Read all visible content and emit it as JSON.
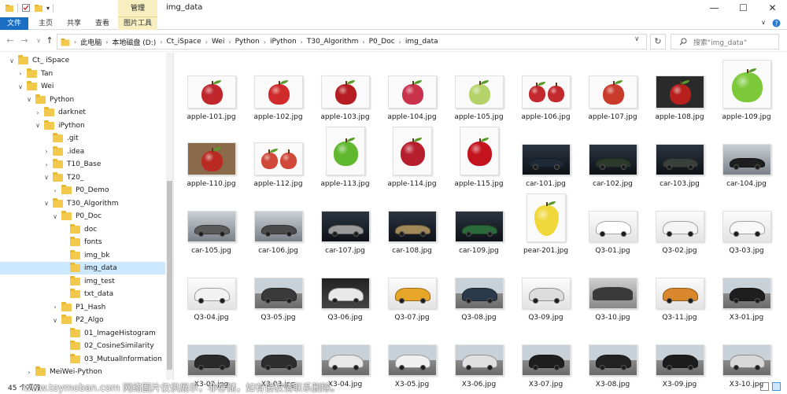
{
  "window": {
    "title": "img_data",
    "manage_tab": "管理",
    "controls": {
      "minimize": "—",
      "maximize": "☐",
      "close": "✕"
    }
  },
  "ribbon": {
    "tabs": [
      "文件",
      "主页",
      "共享",
      "查看",
      "图片工具"
    ],
    "accent": "#1a6fc4",
    "picture_tools_color": "#f7efc0"
  },
  "address": {
    "crumbs": [
      "此电脑",
      "本地磁盘 (D:)",
      "Ct_iSpace",
      "Wei",
      "Python",
      "iPython",
      "T30_Algorithm",
      "P0_Doc",
      "img_data"
    ],
    "search_placeholder": "搜索\"img_data\""
  },
  "nav_tree": [
    {
      "label": "Ct_ iSpace",
      "indent": 0,
      "chev": "∨"
    },
    {
      "label": "Tan",
      "indent": 1,
      "chev": "›"
    },
    {
      "label": "Wei",
      "indent": 1,
      "chev": "∨"
    },
    {
      "label": "Python",
      "indent": 2,
      "chev": "∨"
    },
    {
      "label": "darknet",
      "indent": 3,
      "chev": "›"
    },
    {
      "label": "iPython",
      "indent": 3,
      "chev": "∨"
    },
    {
      "label": ".git",
      "indent": 4,
      "chev": ""
    },
    {
      "label": ".idea",
      "indent": 4,
      "chev": "›"
    },
    {
      "label": "T10_Base",
      "indent": 4,
      "chev": "›"
    },
    {
      "label": "T20_",
      "indent": 4,
      "chev": "∨"
    },
    {
      "label": "P0_Demo",
      "indent": 5,
      "chev": "›"
    },
    {
      "label": "T30_Algorithm",
      "indent": 4,
      "chev": "∨"
    },
    {
      "label": "P0_Doc",
      "indent": 5,
      "chev": "∨"
    },
    {
      "label": "doc",
      "indent": 6,
      "chev": ""
    },
    {
      "label": "fonts",
      "indent": 6,
      "chev": ""
    },
    {
      "label": "img_bk",
      "indent": 6,
      "chev": ""
    },
    {
      "label": "img_data",
      "indent": 6,
      "chev": "",
      "selected": true
    },
    {
      "label": "img_test",
      "indent": 6,
      "chev": ""
    },
    {
      "label": "txt_data",
      "indent": 6,
      "chev": ""
    },
    {
      "label": "P1_Hash",
      "indent": 5,
      "chev": "›"
    },
    {
      "label": "P2_Algo",
      "indent": 5,
      "chev": "∨"
    },
    {
      "label": "01_ImageHistogram",
      "indent": 6,
      "chev": ""
    },
    {
      "label": "02_CosineSimilarity",
      "indent": 6,
      "chev": ""
    },
    {
      "label": "03_MutualInformation",
      "indent": 6,
      "chev": ""
    },
    {
      "label": "MeiWei-Python",
      "indent": 2,
      "chev": "›"
    }
  ],
  "files": [
    {
      "name": "apple-101.jpg",
      "kind": "apple",
      "color": "#c0272d"
    },
    {
      "name": "apple-102.jpg",
      "kind": "apple",
      "color": "#d02a2a"
    },
    {
      "name": "apple-103.jpg",
      "kind": "apple",
      "color": "#b51d22"
    },
    {
      "name": "apple-104.jpg",
      "kind": "apple",
      "color": "#c8324a"
    },
    {
      "name": "apple-105.jpg",
      "kind": "apple",
      "color": "#b5d36a"
    },
    {
      "name": "apple-106.jpg",
      "kind": "apple2",
      "color": "#c2282c"
    },
    {
      "name": "apple-107.jpg",
      "kind": "apple",
      "color": "#c93a2a"
    },
    {
      "name": "apple-108.jpg",
      "kind": "apple-dark",
      "color": "#b8201e"
    },
    {
      "name": "apple-109.jpg",
      "kind": "apple",
      "color": "#7cc93a"
    },
    {
      "name": "apple-110.jpg",
      "kind": "apple-wood",
      "color": "#b82a22"
    },
    {
      "name": "apple-112.jpg",
      "kind": "apple2",
      "color": "#d0483a"
    },
    {
      "name": "apple-113.jpg",
      "kind": "apple",
      "color": "#5fb82e"
    },
    {
      "name": "apple-114.jpg",
      "kind": "apple",
      "color": "#b81f2e"
    },
    {
      "name": "apple-115.jpg",
      "kind": "apple",
      "color": "#c3141e"
    },
    {
      "name": "car-101.jpg",
      "kind": "car-dark",
      "color": "#1e2a38"
    },
    {
      "name": "car-102.jpg",
      "kind": "car-dark",
      "color": "#2c3a2c"
    },
    {
      "name": "car-103.jpg",
      "kind": "car-dark",
      "color": "#3a3f3a"
    },
    {
      "name": "car-104.jpg",
      "kind": "car-grey",
      "color": "#1e1e1e"
    },
    {
      "name": "car-105.jpg",
      "kind": "car-grey",
      "color": "#5a5a5a"
    },
    {
      "name": "car-106.jpg",
      "kind": "car-grey",
      "color": "#4a4a4a"
    },
    {
      "name": "car-107.jpg",
      "kind": "car-dark",
      "color": "#9a9a9a"
    },
    {
      "name": "car-108.jpg",
      "kind": "car-dark",
      "color": "#a08858"
    },
    {
      "name": "car-109.jpg",
      "kind": "car-dark",
      "color": "#2a6a3a"
    },
    {
      "name": "pear-201.jpg",
      "kind": "pear",
      "color": "#f0d83a"
    },
    {
      "name": "Q3-01.jpg",
      "kind": "suv",
      "color": "#ffffff"
    },
    {
      "name": "Q3-02.jpg",
      "kind": "suv",
      "color": "#f4f4f4"
    },
    {
      "name": "Q3-03.jpg",
      "kind": "suv",
      "color": "#f8f8f8"
    },
    {
      "name": "Q3-04.jpg",
      "kind": "suv",
      "color": "#f2f2f2"
    },
    {
      "name": "Q3-05.jpg",
      "kind": "suv-road",
      "color": "#3a3a3a"
    },
    {
      "name": "Q3-06.jpg",
      "kind": "suv-dark",
      "color": "#e8e8e8"
    },
    {
      "name": "Q3-07.jpg",
      "kind": "suv",
      "color": "#e8a628"
    },
    {
      "name": "Q3-08.jpg",
      "kind": "suv-road",
      "color": "#2a3a4a"
    },
    {
      "name": "Q3-09.jpg",
      "kind": "suv",
      "color": "#dcdcdc"
    },
    {
      "name": "Q3-10.jpg",
      "kind": "interior",
      "color": "#3a3a3a"
    },
    {
      "name": "Q3-11.jpg",
      "kind": "suv",
      "color": "#d8882a"
    },
    {
      "name": "X3-01.jpg",
      "kind": "suv-road",
      "color": "#1e1e1e"
    },
    {
      "name": "X3-02.jpg",
      "kind": "suv-road",
      "color": "#2a2a2a"
    },
    {
      "name": "X3-03.jpg",
      "kind": "suv-road",
      "color": "#2e2e2e"
    },
    {
      "name": "X3-04.jpg",
      "kind": "suv-road",
      "color": "#e8e8e8"
    },
    {
      "name": "X3-05.jpg",
      "kind": "suv-road",
      "color": "#f0f0f0"
    },
    {
      "name": "X3-06.jpg",
      "kind": "suv-road",
      "color": "#e0e0e0"
    },
    {
      "name": "X3-07.jpg",
      "kind": "suv-road",
      "color": "#1e1e1e"
    },
    {
      "name": "X3-08.jpg",
      "kind": "suv-road",
      "color": "#222222"
    },
    {
      "name": "X3-09.jpg",
      "kind": "suv-road",
      "color": "#1c1c1c"
    },
    {
      "name": "X3-10.jpg",
      "kind": "suv-road",
      "color": "#d8d8d8"
    }
  ],
  "status": {
    "count": "45 个项目",
    "watermark": "www.toymoban.com 网络图片仅供展示，非存储，如有侵权请联系删除。"
  }
}
